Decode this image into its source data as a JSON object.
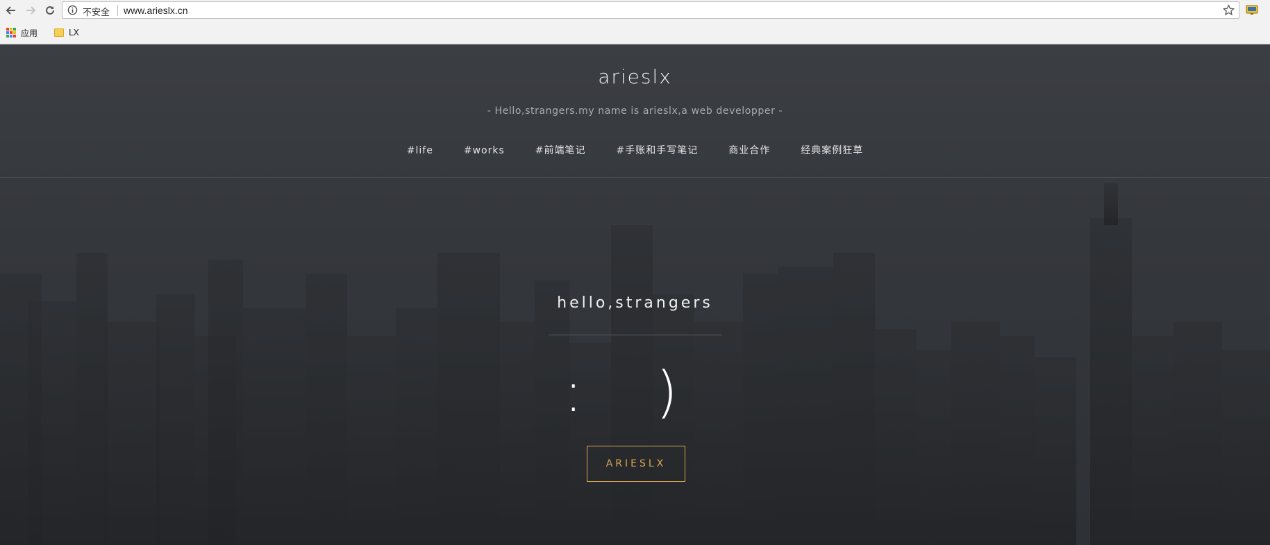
{
  "browser": {
    "security_label": "不安全",
    "url": "www.arieslx.cn",
    "icons": [
      "back-icon",
      "forward-icon",
      "reload-icon",
      "info-icon",
      "star-icon",
      "cast-icon"
    ],
    "bookmarks": [
      {
        "label": "应用",
        "icon": "apps-icon"
      },
      {
        "label": "LX",
        "icon": "folder-icon"
      }
    ]
  },
  "site": {
    "title": "arieslx",
    "subtitle": "- Hello,strangers.my name is arieslx,a web developper -",
    "nav": [
      "#life",
      "#works",
      "#前端笔记",
      "#手账和手写笔记",
      "商业合作",
      "经典案例狂草"
    ]
  },
  "hero": {
    "heading": "hello,strangers",
    "emoticon": ": )",
    "button": "ARIESLX"
  },
  "colors": {
    "accent": "#d8a74e",
    "background": "#34373b",
    "text": "#f0f0f0"
  }
}
